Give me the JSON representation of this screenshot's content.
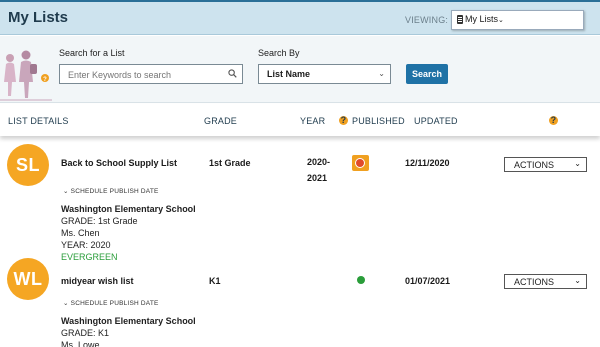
{
  "header": {
    "title": "My Lists",
    "viewing_label": "VIEWING:",
    "viewing_value": "My Lists",
    "viewing_chevron": "⌄"
  },
  "search": {
    "search_label": "Search for a List",
    "placeholder": "Enter Keywords to search",
    "search_by_label": "Search By",
    "search_by_value": "List Name",
    "button_label": "Search"
  },
  "columns": {
    "details": "LIST DETAILS",
    "grade": "GRADE",
    "year": "YEAR",
    "published": "PUBLISHED",
    "updated": "UPDATED",
    "help": "?"
  },
  "rows": [
    {
      "initials": "SL",
      "name": "Back to School Supply List",
      "grade": "1st Grade",
      "year_line1": "2020-",
      "year_line2": "2021",
      "published_status": "unpublished",
      "updated": "12/11/2020",
      "actions_label": "ACTIONS",
      "schedule_label": "⌄ SCHEDULE PUBLISH DATE",
      "school": "Washington Elementary School",
      "grade_detail": "GRADE: 1st Grade",
      "teacher": "Ms. Chen",
      "year_detail": "YEAR: 2020",
      "tag": "EVERGREEN"
    },
    {
      "initials": "WL",
      "name": "midyear wish list",
      "grade": "K1",
      "published_status": "published",
      "updated": "01/07/2021",
      "actions_label": "ACTIONS",
      "schedule_label": "⌄ SCHEDULE PUBLISH DATE",
      "school": "Washington Elementary School",
      "grade_detail": "GRADE: K1",
      "teacher": "Ms. Lowe"
    }
  ],
  "colors": {
    "avatar": "#f5a623",
    "search_button": "#1f72a6",
    "published_green": "#2a9d3a",
    "evergreen_text": "#2a9d3a",
    "header_bg": "#cde3ee"
  }
}
